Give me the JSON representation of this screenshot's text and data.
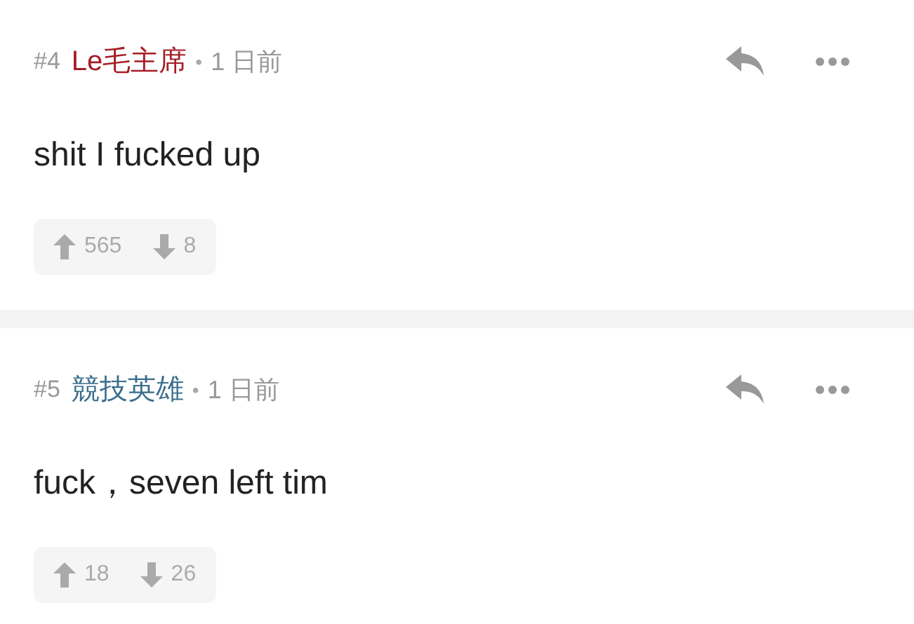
{
  "comments": [
    {
      "number": "#4",
      "username": "Le毛主席",
      "color": "#a51d25",
      "separator": "•",
      "time": "1 日前",
      "text": "shit I fucked up",
      "upvotes": "565",
      "downvotes": "8"
    },
    {
      "number": "#5",
      "username": "競技英雄",
      "color": "#3a6e8c",
      "separator": "•",
      "time": "1 日前",
      "text": "fuck，seven left tim",
      "upvotes": "18",
      "downvotes": "26"
    }
  ]
}
